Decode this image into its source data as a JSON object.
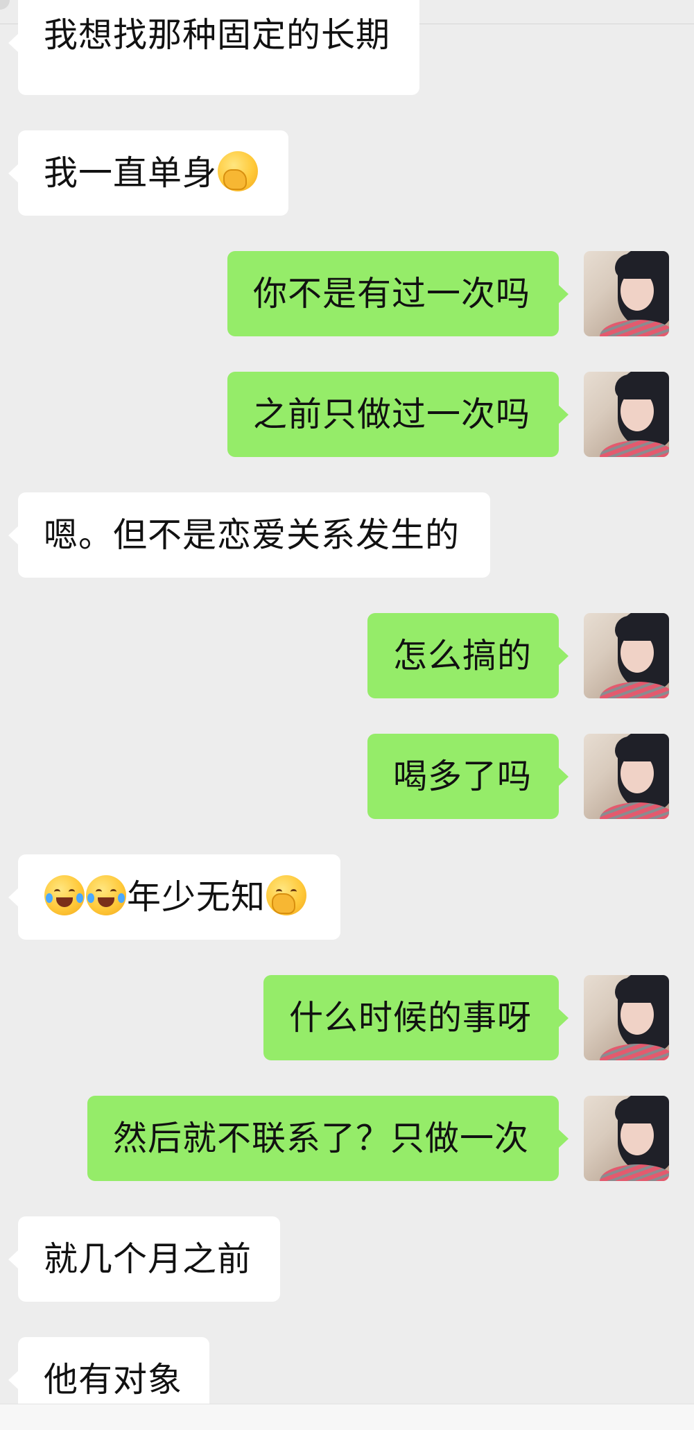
{
  "messages": [
    {
      "side": "in",
      "text": "我想找那种固定的长期"
    },
    {
      "side": "in",
      "text": "我一直单身",
      "emoji_after": "facepalm-emoji"
    },
    {
      "side": "out",
      "text": "你不是有过一次吗"
    },
    {
      "side": "out",
      "text": "之前只做过一次吗"
    },
    {
      "side": "in",
      "text": "嗯。但不是恋爱关系发生的"
    },
    {
      "side": "out",
      "text": "怎么搞的"
    },
    {
      "side": "out",
      "text": "喝多了吗"
    },
    {
      "side": "in",
      "text": "年少无知",
      "emoji_before": [
        "tears-of-joy-emoji",
        "tears-of-joy-emoji"
      ],
      "emoji_after": "face-with-hand-over-mouth-emoji"
    },
    {
      "side": "out",
      "text": "什么时候的事呀"
    },
    {
      "side": "out",
      "text": "然后就不联系了？只做一次"
    },
    {
      "side": "in",
      "text": "就几个月之前"
    },
    {
      "side": "in",
      "text": "他有对象"
    }
  ],
  "colors": {
    "background": "#ededed",
    "incoming_bubble": "#ffffff",
    "outgoing_bubble": "#95ec69"
  },
  "icons": {
    "avatar": "user-avatar-photo"
  }
}
